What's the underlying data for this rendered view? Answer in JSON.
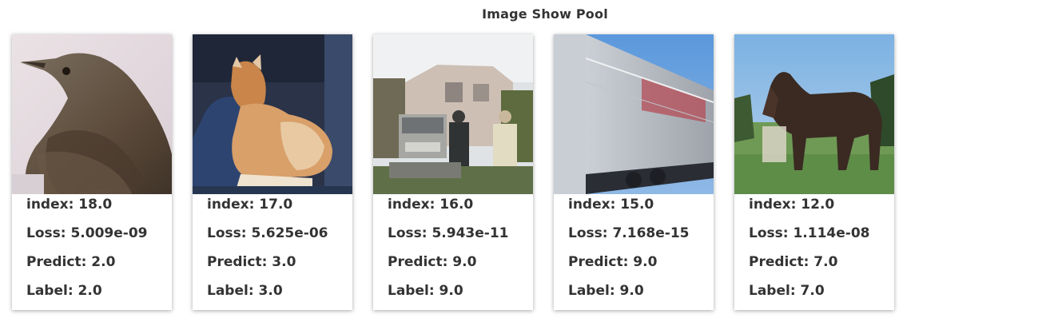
{
  "title": "Image Show Pool",
  "cards": [
    {
      "image": "bird-photo",
      "index": "index: 18.0",
      "loss": "Loss: 5.009e-09",
      "predict": "Predict: 2.0",
      "label": "Label: 2.0"
    },
    {
      "image": "cat-photo",
      "index": "index: 17.0",
      "loss": "Loss: 5.625e-06",
      "predict": "Predict: 3.0",
      "label": "Label: 3.0"
    },
    {
      "image": "truck-photo",
      "index": "index: 16.0",
      "loss": "Loss: 5.943e-11",
      "predict": "Predict: 9.0",
      "label": "Label: 9.0"
    },
    {
      "image": "trailer-truck-photo",
      "index": "index: 15.0",
      "loss": "Loss: 7.168e-15",
      "predict": "Predict: 9.0",
      "label": "Label: 9.0"
    },
    {
      "image": "horse-photo",
      "index": "index: 12.0",
      "loss": "Loss: 1.114e-08",
      "predict": "Predict: 7.0",
      "label": "Label: 7.0"
    }
  ]
}
